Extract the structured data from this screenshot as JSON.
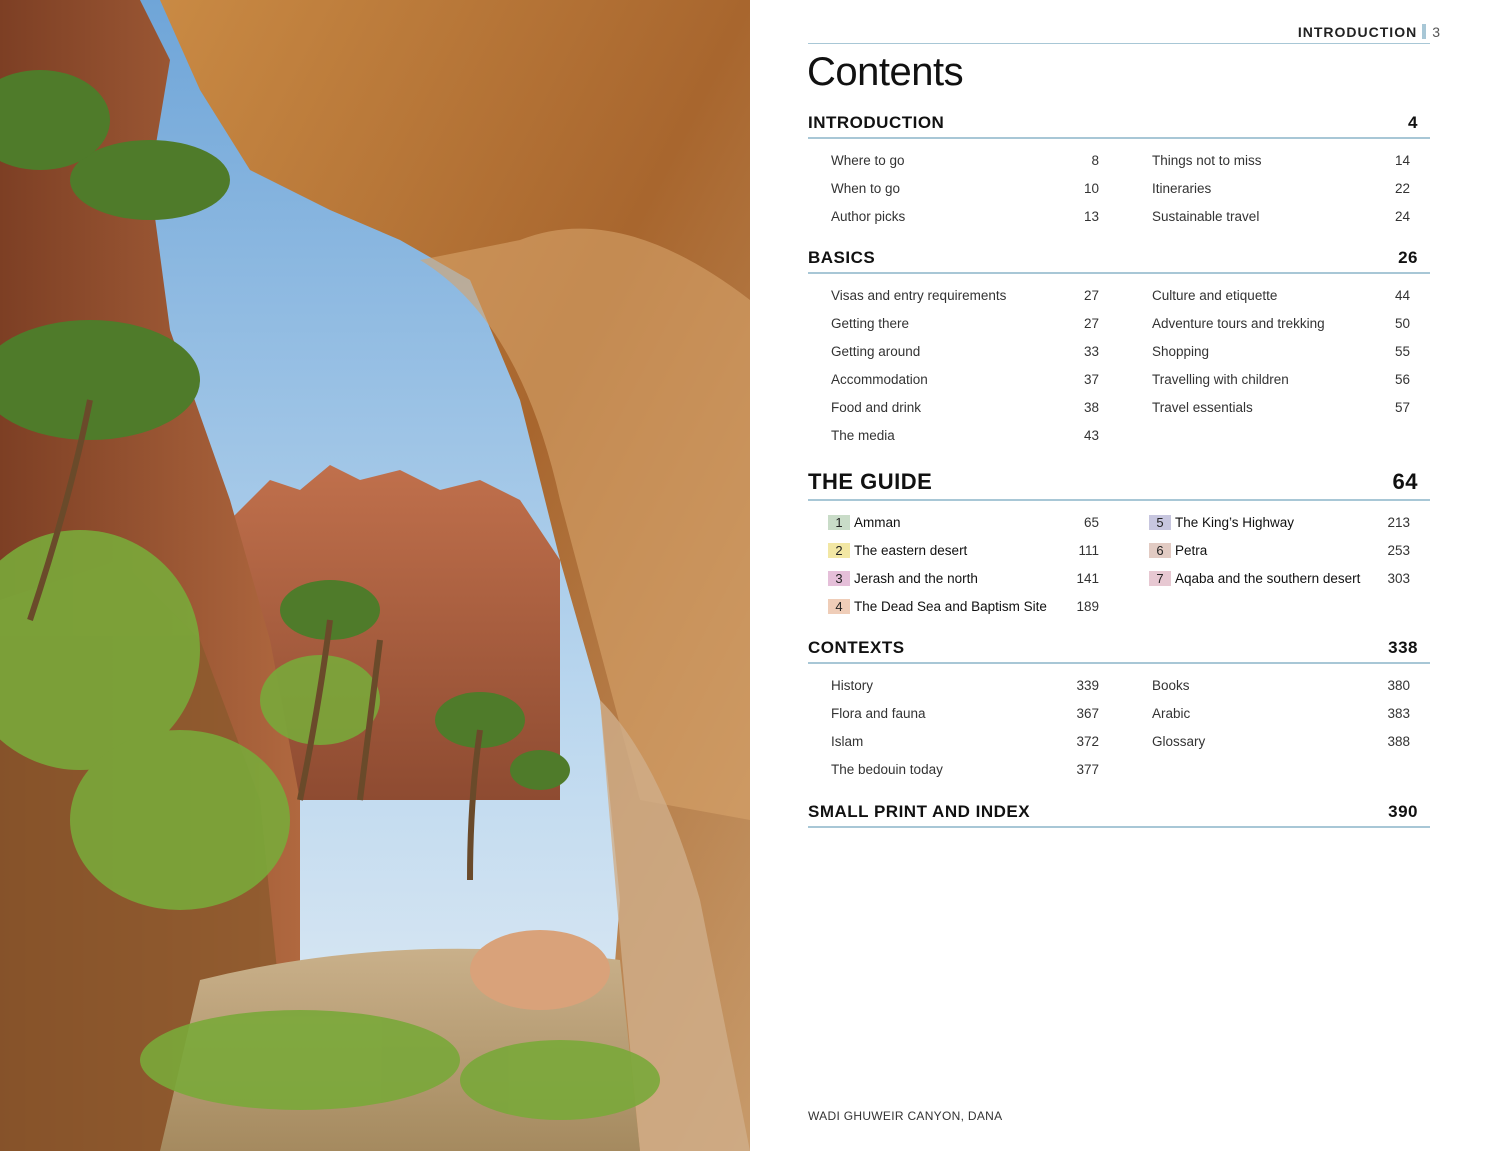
{
  "header": {
    "running_title": "INTRODUCTION",
    "page_number": "3"
  },
  "title": "Contents",
  "sections": [
    {
      "title": "INTRODUCTION",
      "page": "4",
      "left": [
        {
          "label": "Where to go",
          "page": "8"
        },
        {
          "label": "When to go",
          "page": "10"
        },
        {
          "label": "Author picks",
          "page": "13"
        }
      ],
      "right": [
        {
          "label": "Things not to miss",
          "page": "14"
        },
        {
          "label": "Itineraries",
          "page": "22"
        },
        {
          "label": "Sustainable travel",
          "page": "24"
        }
      ]
    },
    {
      "title": "BASICS",
      "page": "26",
      "left": [
        {
          "label": "Visas and entry requirements",
          "page": "27"
        },
        {
          "label": "Getting there",
          "page": "27"
        },
        {
          "label": "Getting around",
          "page": "33"
        },
        {
          "label": "Accommodation",
          "page": "37"
        },
        {
          "label": "Food and drink",
          "page": "38"
        },
        {
          "label": "The media",
          "page": "43"
        }
      ],
      "right": [
        {
          "label": "Culture and etiquette",
          "page": "44"
        },
        {
          "label": "Adventure tours and trekking",
          "page": "50"
        },
        {
          "label": "Shopping",
          "page": "55"
        },
        {
          "label": "Travelling with children",
          "page": "56"
        },
        {
          "label": "Travel essentials",
          "page": "57"
        }
      ]
    },
    {
      "title": "THE GUIDE",
      "page": "64",
      "left": [
        {
          "num": "1",
          "label": "Amman",
          "page": "65",
          "color": "#c9dcc8"
        },
        {
          "num": "2",
          "label": "The eastern desert",
          "page": "111",
          "color": "#f2e7a4"
        },
        {
          "num": "3",
          "label": "Jerash and the north",
          "page": "141",
          "color": "#e5bfd9"
        },
        {
          "num": "4",
          "label": "The Dead Sea and Baptism Site",
          "page": "189",
          "color": "#efcdb8"
        }
      ],
      "right": [
        {
          "num": "5",
          "label": "The King’s Highway",
          "page": "213",
          "color": "#c7c6df"
        },
        {
          "num": "6",
          "label": "Petra",
          "page": "253",
          "color": "#e2cbc3"
        },
        {
          "num": "7",
          "label": "Aqaba and the southern desert",
          "page": "303",
          "color": "#e7c8d2"
        }
      ]
    },
    {
      "title": "CONTEXTS",
      "page": "338",
      "left": [
        {
          "label": "History",
          "page": "339"
        },
        {
          "label": "Flora and fauna",
          "page": "367"
        },
        {
          "label": "Islam",
          "page": "372"
        },
        {
          "label": "The bedouin today",
          "page": "377"
        }
      ],
      "right": [
        {
          "label": "Books",
          "page": "380"
        },
        {
          "label": "Arabic",
          "page": "383"
        },
        {
          "label": "Glossary",
          "page": "388"
        }
      ]
    },
    {
      "title": "SMALL PRINT AND INDEX",
      "page": "390",
      "left": [],
      "right": []
    }
  ],
  "caption": "WADI GHUWEIR CANYON, DANA"
}
